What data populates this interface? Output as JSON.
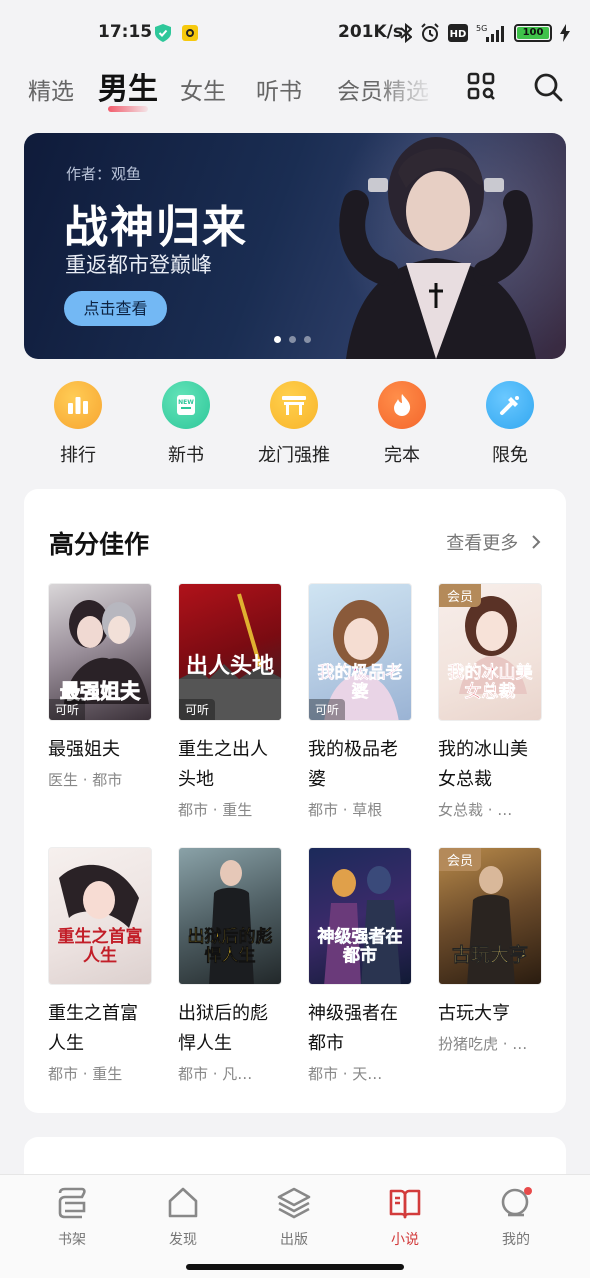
{
  "status_bar": {
    "time": "17:15",
    "net_speed": "201K/s",
    "battery": "100"
  },
  "tabs": [
    {
      "label": "精选"
    },
    {
      "label": "男生"
    },
    {
      "label": "女生"
    },
    {
      "label": "听书"
    },
    {
      "label": "会员精选"
    }
  ],
  "banner": {
    "author": "作者：观鱼",
    "title": "战神归来",
    "subtitle": "重返都市登巅峰",
    "cta": "点击查看"
  },
  "categories": [
    {
      "label": "排行",
      "color": "#f7a531"
    },
    {
      "label": "新书",
      "color": "#2ec79a"
    },
    {
      "label": "龙门强推",
      "color": "#f8b42a"
    },
    {
      "label": "完本",
      "color": "#f4662c"
    },
    {
      "label": "限免",
      "color": "#32a7f0"
    }
  ],
  "section": {
    "title": "高分佳作",
    "more": "查看更多",
    "books": [
      {
        "name": "最强姐夫",
        "tags": "医生 · 都市",
        "badge_listen": "可听",
        "badge_vip": "",
        "cover_text": "最强姐夫"
      },
      {
        "name": "重生之出人头地",
        "tags": "都市 · 重生",
        "badge_listen": "可听",
        "badge_vip": "",
        "cover_text": "出人头地"
      },
      {
        "name": "我的极品老婆",
        "tags": "都市 · 草根",
        "badge_listen": "可听",
        "badge_vip": "",
        "cover_text": "我的极品老婆"
      },
      {
        "name": "我的冰山美女总裁",
        "tags": "女总裁 · …",
        "badge_listen": "",
        "badge_vip": "会员",
        "cover_text": "我的冰山美女总裁"
      },
      {
        "name": "重生之首富人生",
        "tags": "都市 · 重生",
        "badge_listen": "",
        "badge_vip": "",
        "cover_text": "重生之首富人生"
      },
      {
        "name": "出狱后的彪悍人生",
        "tags": "都市 · 凡…",
        "badge_listen": "",
        "badge_vip": "",
        "cover_text": "出狱后的彪悍人生"
      },
      {
        "name": "神级强者在都市",
        "tags": "都市 · 天…",
        "badge_listen": "",
        "badge_vip": "",
        "cover_text": "神级强者在都市"
      },
      {
        "name": "古玩大亨",
        "tags": "扮猪吃虎 · …",
        "badge_listen": "",
        "badge_vip": "会员",
        "cover_text": "古玩大亨"
      }
    ]
  },
  "bottom_nav": [
    {
      "label": "书架"
    },
    {
      "label": "发现"
    },
    {
      "label": "出版"
    },
    {
      "label": "小说"
    },
    {
      "label": "我的"
    }
  ]
}
